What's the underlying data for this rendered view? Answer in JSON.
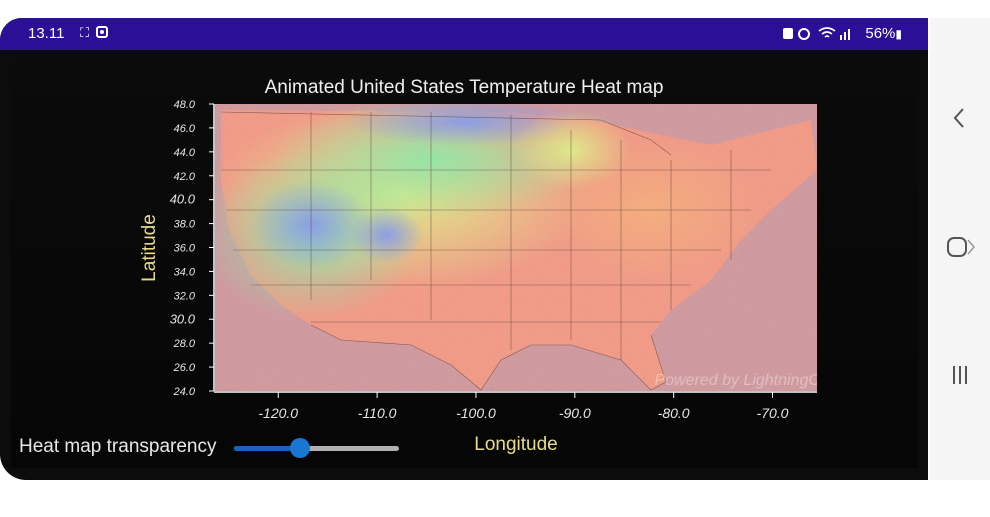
{
  "status_bar": {
    "time": "13.11",
    "battery": "56%",
    "icons": [
      "screenshot-icon",
      "photo-icon",
      "alarm-icon",
      "wifi-icon",
      "signal-icon",
      "battery-icon"
    ]
  },
  "chart_data": {
    "type": "heatmap",
    "title": "Animated United States Temperature Heat map",
    "xlabel": "Longitude",
    "ylabel": "Latitude",
    "xlim": [
      -126.5,
      -65.5
    ],
    "ylim": [
      24.0,
      48.0
    ],
    "x_ticks": [
      "-120.0",
      "-110.0",
      "-100.0",
      "-90.0",
      "-80.0",
      "-70.0"
    ],
    "x_tick_values": [
      -120,
      -110,
      -100,
      -90,
      -80,
      -70
    ],
    "y_ticks": [
      "48.0",
      "46.0",
      "44.0",
      "42.0",
      "40.0",
      "38.0",
      "36.0",
      "34.0",
      "32.0",
      "30.0",
      "28.0",
      "26.0",
      "24.0"
    ],
    "y_tick_values": [
      48,
      46,
      44,
      42,
      40,
      38,
      36,
      34,
      32,
      30,
      28,
      26,
      24
    ],
    "colors": {
      "cold": "#7b8fe6",
      "cool": "#7fe3a0",
      "mild": "#d8f07a",
      "warm": "#f3a76c",
      "hot": "#e87f7a",
      "ocean": "#c98e93"
    },
    "watermark": "Powered by LightningChart"
  },
  "controls": {
    "transparency_label": "Heat map transparency",
    "transparency_value": 0.4
  },
  "nav": {
    "back": "back-icon",
    "home": "home-icon",
    "recents": "recents-icon"
  }
}
